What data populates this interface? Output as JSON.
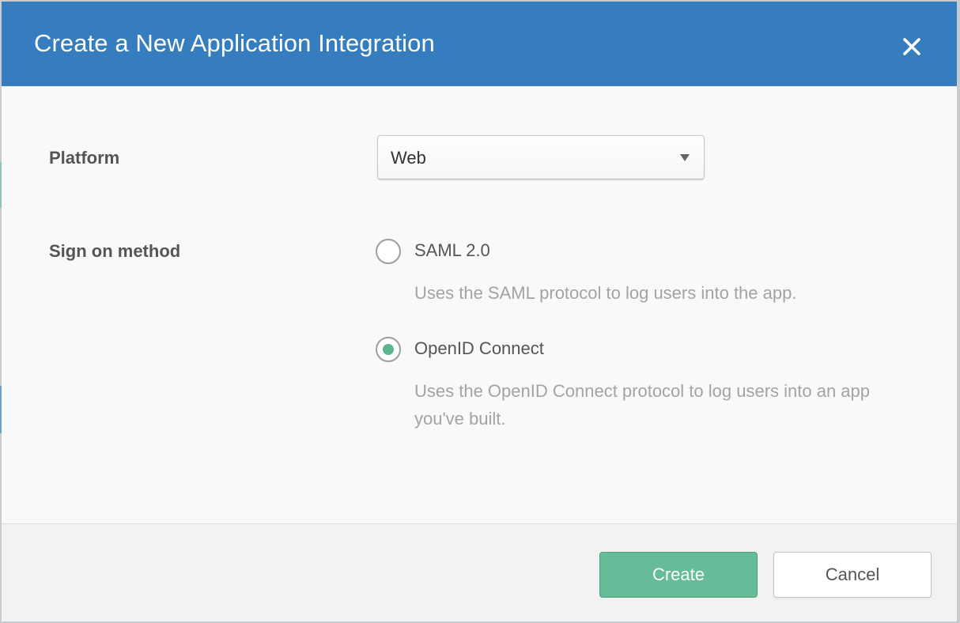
{
  "dialog": {
    "title": "Create a New Application Integration",
    "close_icon": "close-icon"
  },
  "form": {
    "platform": {
      "label": "Platform",
      "selected_value": "Web"
    },
    "sign_on_method": {
      "label": "Sign on method",
      "options": [
        {
          "label": "SAML 2.0",
          "description": "Uses the SAML protocol to log users into the app.",
          "checked": false
        },
        {
          "label": "OpenID Connect",
          "description": "Uses the OpenID Connect protocol to log users into an app you've built.",
          "checked": true
        }
      ]
    }
  },
  "footer": {
    "create_label": "Create",
    "cancel_label": "Cancel"
  },
  "colors": {
    "header_bg": "#357dbe",
    "primary_button": "#66bb98",
    "radio_checked": "#5bb58e"
  }
}
